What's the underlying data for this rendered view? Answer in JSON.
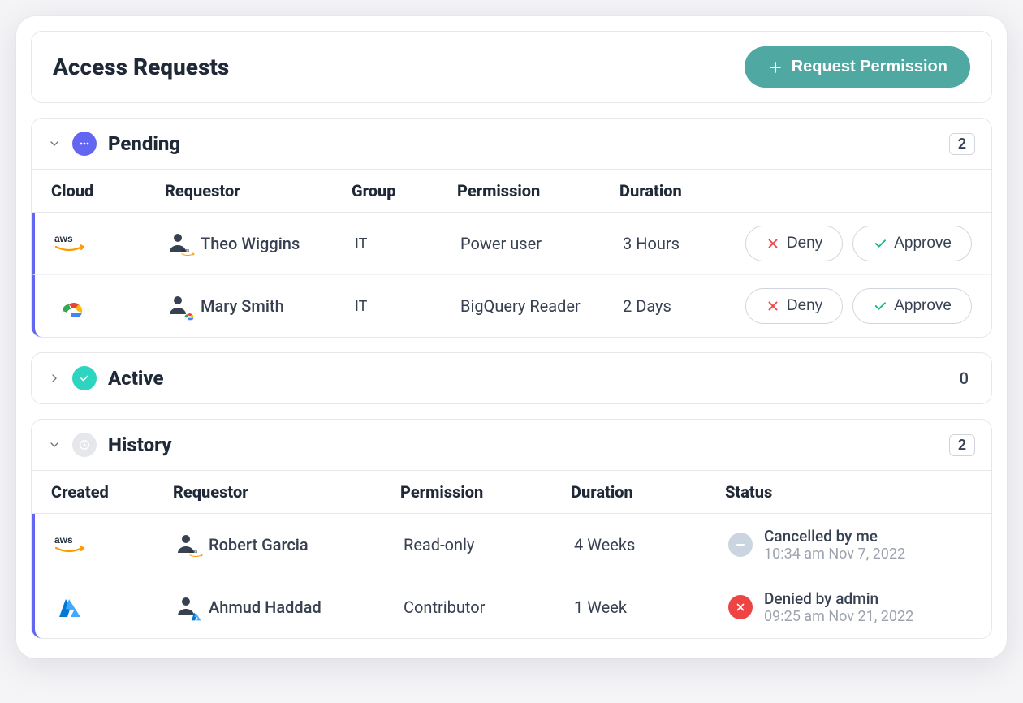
{
  "header": {
    "title": "Access Requests",
    "request_button_label": "Request Permission"
  },
  "sections": {
    "pending": {
      "title": "Pending",
      "count": "2",
      "expanded": true,
      "columns": [
        "Cloud",
        "Requestor",
        "Group",
        "Permission",
        "Duration"
      ],
      "rows": [
        {
          "cloud": "aws",
          "requestor_name": "Theo Wiggins",
          "requestor_badge": "aws",
          "group": "IT",
          "permission": "Power user",
          "duration": "3 Hours"
        },
        {
          "cloud": "gcp",
          "requestor_name": "Mary Smith",
          "requestor_badge": "gcp",
          "group": "IT",
          "permission": "BigQuery Reader",
          "duration": "2 Days"
        }
      ],
      "deny_label": "Deny",
      "approve_label": "Approve"
    },
    "active": {
      "title": "Active",
      "count": "0",
      "expanded": false
    },
    "history": {
      "title": "History",
      "count": "2",
      "expanded": true,
      "columns": [
        "Created",
        "Requestor",
        "Permission",
        "Duration",
        "Status"
      ],
      "rows": [
        {
          "cloud": "aws",
          "requestor_name": "Robert Garcia",
          "requestor_badge": "aws",
          "permission": "Read-only",
          "duration": "4 Weeks",
          "status_type": "cancelled",
          "status_label": "Cancelled by me",
          "status_time": "10:34 am Nov 7, 2022"
        },
        {
          "cloud": "azure",
          "requestor_name": "Ahmud Haddad",
          "requestor_badge": "azure",
          "permission": "Contributor",
          "duration": "1 Week",
          "status_type": "denied",
          "status_label": "Denied by admin",
          "status_time": "09:25 am Nov 21, 2022"
        }
      ]
    }
  }
}
